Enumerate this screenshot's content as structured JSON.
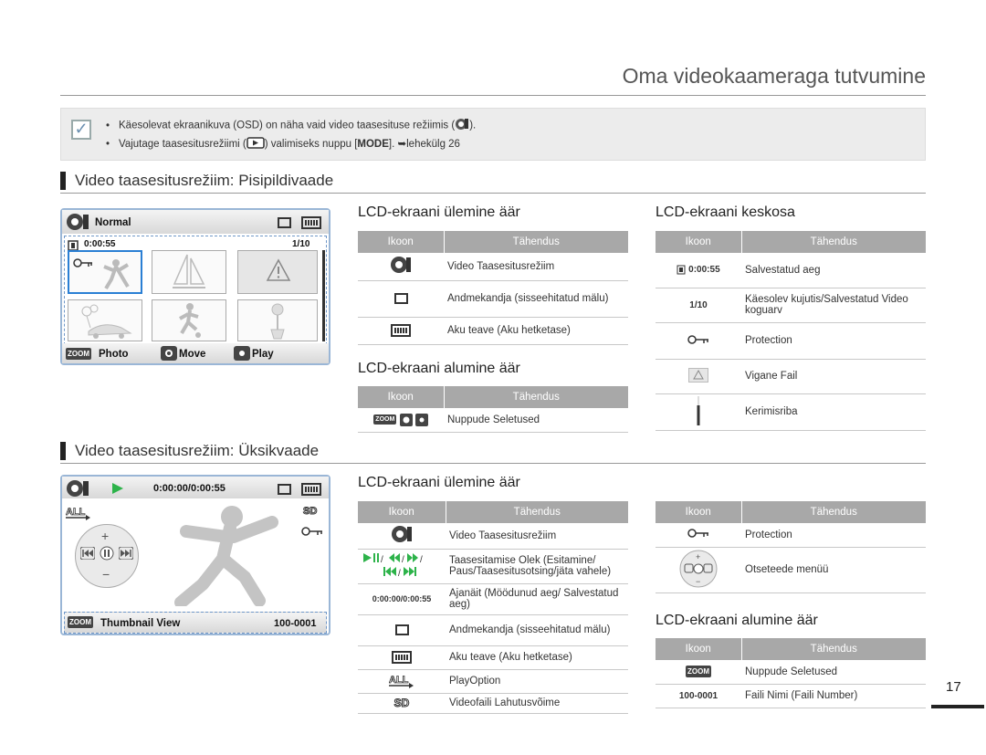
{
  "page_title": "Oma videokaameraga tutvumine",
  "notes": [
    "Käesolevat ekraanikuva (OSD) on näha vaid video taasesituse režiimis (",
    ").",
    "Vajutage taasesitusrežiimi (",
    ") valimiseks nuppu [",
    "MODE",
    "].",
    "lehekülg 26"
  ],
  "section1": {
    "title": "Video taasesitusrežiim: Pisipildivaade",
    "lcd": {
      "mode_label": "Normal",
      "time": "0:00:55",
      "counter": "1/10",
      "btn_photo": "Photo",
      "btn_move": "Move",
      "btn_play": "Play",
      "zoom": "ZOOM"
    },
    "top_edge": {
      "heading": "LCD-ekraani ülemine äär",
      "col_icon": "Ikoon",
      "col_meaning": "Tähendus",
      "rows": [
        "Video Taasesitusrežiim",
        "Andmekandja (sisseehitatud mälu)",
        "Aku teave (Aku hetketase)"
      ]
    },
    "bottom_edge": {
      "heading": "LCD-ekraani alumine äär",
      "col_icon": "Ikoon",
      "col_meaning": "Tähendus",
      "rows": [
        "Nuppude Seletused"
      ]
    },
    "center": {
      "heading": "LCD-ekraani keskosa",
      "col_icon": "Ikoon",
      "col_meaning": "Tähendus",
      "rows": [
        {
          "icon_text": "0:00:55",
          "meaning": "Salvestatud aeg"
        },
        {
          "icon_text": "1/10",
          "meaning": "Käesolev kujutis/Salvestatud Video koguarv"
        },
        {
          "icon_text": "",
          "meaning": "Protection"
        },
        {
          "icon_text": "",
          "meaning": "Vigane Fail"
        },
        {
          "icon_text": "",
          "meaning": "Kerimisriba"
        }
      ]
    }
  },
  "section2": {
    "title": "Video taasesitusrežiim: Üksikvaade",
    "lcd": {
      "time": "0:00:00/0:00:55",
      "res": "SD",
      "zoom": "ZOOM",
      "thumbnail_view": "Thumbnail View",
      "file_number": "100-0001"
    },
    "top_edge": {
      "heading": "LCD-ekraani ülemine äär",
      "col_icon": "Ikoon",
      "col_meaning": "Tähendus",
      "rows": [
        {
          "icon_text": "",
          "meaning": "Video Taasesitusrežiim"
        },
        {
          "icon_text": "",
          "meaning": "Taasesitamise Olek (Esitamine/ Paus/Taasesitusotsing/jäta vahele)"
        },
        {
          "icon_text": "0:00:00/0:00:55",
          "meaning": "Ajanäit (Möödunud aeg/ Salvestatud aeg)"
        },
        {
          "icon_text": "",
          "meaning": "Andmekandja (sisseehitatud mälu)"
        },
        {
          "icon_text": "",
          "meaning": "Aku teave (Aku hetketase)"
        },
        {
          "icon_text": "",
          "meaning": "PlayOption"
        },
        {
          "icon_text": "SD",
          "meaning": "Videofaili Lahutusvõime"
        }
      ]
    },
    "right_table": {
      "col_icon": "Ikoon",
      "col_meaning": "Tähendus",
      "rows": [
        "Protection",
        "Otseteede menüü"
      ]
    },
    "bottom_edge": {
      "heading": "LCD-ekraani alumine äär",
      "col_icon": "Ikoon",
      "col_meaning": "Tähendus",
      "rows": [
        {
          "icon_text": "ZOOM",
          "meaning": "Nuppude Seletused"
        },
        {
          "icon_text": "100-0001",
          "meaning": "Faili Nimi (Faili Number)"
        }
      ]
    }
  },
  "page_number": "17",
  "colors": {
    "accent_blue": "#9ab6d6",
    "header_gray": "#a8a8a8",
    "play_green": "#2db34a"
  }
}
